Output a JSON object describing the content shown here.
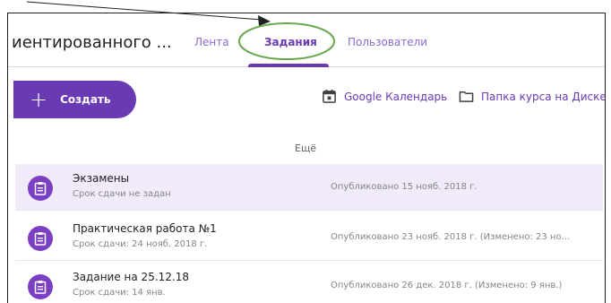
{
  "header": {
    "course_title": "иентированного ...",
    "tabs": [
      {
        "label": "Лента"
      },
      {
        "label": "Задания"
      },
      {
        "label": "Пользователи"
      }
    ]
  },
  "toolbar": {
    "create_label": "Создать",
    "create_icon": "plus-icon",
    "calendar_label": "Google Календарь",
    "calendar_icon": "calendar-icon",
    "drive_label": "Папка курса на Диске",
    "drive_icon": "folder-icon"
  },
  "more_label": "Ещё",
  "assignments": [
    {
      "title": "Экзамены",
      "due": "Срок сдачи не задан",
      "published": "Опубликовано 15 нояб. 2018 г."
    },
    {
      "title": "Практическая работа №1",
      "due": "Срок сдачи: 24 нояб. 2018 г.",
      "published": "Опубликовано 23 нояб. 2018 г. (Изменено: 23 но..."
    },
    {
      "title": "Задание на 25.12.18",
      "due": "Срок сдачи: 14 янв.",
      "published": "Опубликовано 26 дек. 2018 г. (Изменено: 9 янв.)"
    }
  ],
  "colors": {
    "accent": "#6a3ab5",
    "highlight_row": "#f1eaf8",
    "annotation_ellipse": "#6aa84f"
  }
}
